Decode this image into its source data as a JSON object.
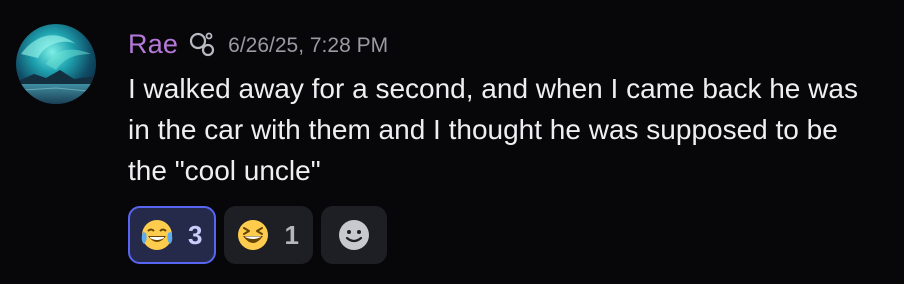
{
  "message": {
    "author": "Rae",
    "timestamp": "6/26/25, 7:28 PM",
    "text": "I walked away for a second, and when I came back he was in the car with them and I thought he was supposed to be the \"cool uncle\"",
    "author_color": "#b57ad9",
    "avatar_icon": "aurora-landscape-avatar",
    "badge_icon": "bubbles-badge-icon"
  },
  "reactions": [
    {
      "emoji": "face-with-tears-of-joy",
      "count": "3",
      "active": true
    },
    {
      "emoji": "grinning-squinting-face",
      "count": "1",
      "active": false
    }
  ],
  "add_reaction": {
    "icon": "add-reaction-smiley-icon"
  },
  "colors": {
    "background": "#070709",
    "active_reaction_border": "#5865f2",
    "reaction_bg": "#1e1f24"
  }
}
